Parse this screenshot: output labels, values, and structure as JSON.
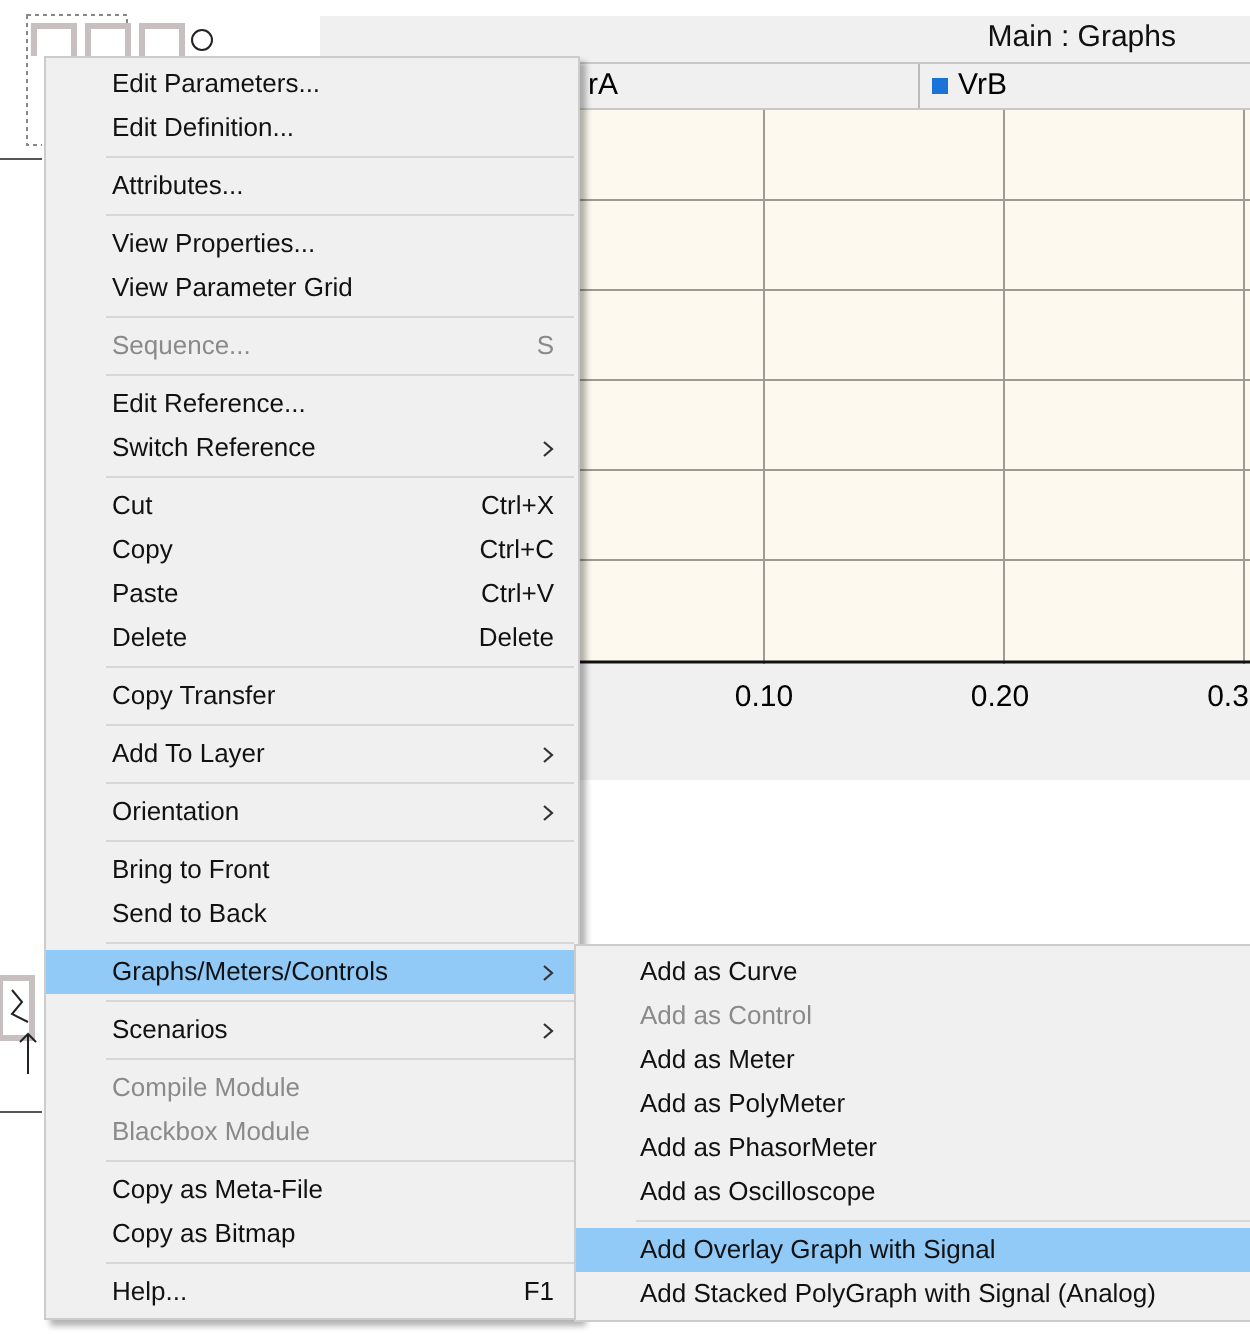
{
  "graph_panel": {
    "title": "Main : Graphs",
    "legend": [
      {
        "label": "rA"
      },
      {
        "label": "VrB",
        "color": "#1a73d9"
      }
    ],
    "x_ticks": [
      "0.10",
      "0.20",
      "0.3"
    ]
  },
  "context_menu": {
    "groups": [
      [
        {
          "label": "Edit Parameters...",
          "submenu": false,
          "disabled": false,
          "selected": false
        },
        {
          "label": "Edit Definition...",
          "submenu": false,
          "disabled": false,
          "selected": false
        }
      ],
      [
        {
          "label": "Attributes...",
          "submenu": false,
          "disabled": false,
          "selected": false
        }
      ],
      [
        {
          "label": "View Properties...",
          "submenu": false,
          "disabled": false,
          "selected": false
        },
        {
          "label": "View Parameter Grid",
          "submenu": false,
          "disabled": false,
          "selected": false
        }
      ],
      [
        {
          "label": "Sequence...",
          "shortcut": "S",
          "submenu": false,
          "disabled": true,
          "selected": false
        }
      ],
      [
        {
          "label": "Edit Reference...",
          "submenu": false,
          "disabled": false,
          "selected": false
        },
        {
          "label": "Switch Reference",
          "submenu": true,
          "disabled": false,
          "selected": false
        }
      ],
      [
        {
          "label": "Cut",
          "shortcut": "Ctrl+X",
          "submenu": false,
          "disabled": false,
          "selected": false
        },
        {
          "label": "Copy",
          "shortcut": "Ctrl+C",
          "submenu": false,
          "disabled": false,
          "selected": false
        },
        {
          "label": "Paste",
          "shortcut": "Ctrl+V",
          "submenu": false,
          "disabled": false,
          "selected": false
        },
        {
          "label": "Delete",
          "shortcut": "Delete",
          "submenu": false,
          "disabled": false,
          "selected": false
        }
      ],
      [
        {
          "label": "Copy Transfer",
          "submenu": false,
          "disabled": false,
          "selected": false
        }
      ],
      [
        {
          "label": "Add To Layer",
          "submenu": true,
          "disabled": false,
          "selected": false
        }
      ],
      [
        {
          "label": "Orientation",
          "submenu": true,
          "disabled": false,
          "selected": false
        }
      ],
      [
        {
          "label": "Bring to Front",
          "submenu": false,
          "disabled": false,
          "selected": false
        },
        {
          "label": "Send to Back",
          "submenu": false,
          "disabled": false,
          "selected": false
        }
      ],
      [
        {
          "label": "Graphs/Meters/Controls",
          "submenu": true,
          "disabled": false,
          "selected": true
        }
      ],
      [
        {
          "label": "Scenarios",
          "submenu": true,
          "disabled": false,
          "selected": false
        }
      ],
      [
        {
          "label": "Compile Module",
          "submenu": false,
          "disabled": true,
          "selected": false
        },
        {
          "label": "Blackbox Module",
          "submenu": false,
          "disabled": true,
          "selected": false
        }
      ],
      [
        {
          "label": "Copy as Meta-File",
          "submenu": false,
          "disabled": false,
          "selected": false
        },
        {
          "label": "Copy as Bitmap",
          "submenu": false,
          "disabled": false,
          "selected": false
        }
      ],
      [
        {
          "label": "Help...",
          "shortcut": "F1",
          "submenu": false,
          "disabled": false,
          "selected": false
        }
      ]
    ]
  },
  "submenu": {
    "groups": [
      [
        {
          "label": "Add as Curve",
          "disabled": false,
          "selected": false
        },
        {
          "label": "Add as Control",
          "disabled": true,
          "selected": false
        },
        {
          "label": "Add as Meter",
          "disabled": false,
          "selected": false
        },
        {
          "label": "Add as PolyMeter",
          "disabled": false,
          "selected": false
        },
        {
          "label": "Add as PhasorMeter",
          "disabled": false,
          "selected": false
        },
        {
          "label": "Add as Oscilloscope",
          "disabled": false,
          "selected": false
        }
      ],
      [
        {
          "label": "Add Overlay Graph with Signal",
          "disabled": false,
          "selected": true
        },
        {
          "label": "Add Stacked PolyGraph with Signal (Analog)",
          "disabled": false,
          "selected": false
        }
      ]
    ]
  }
}
